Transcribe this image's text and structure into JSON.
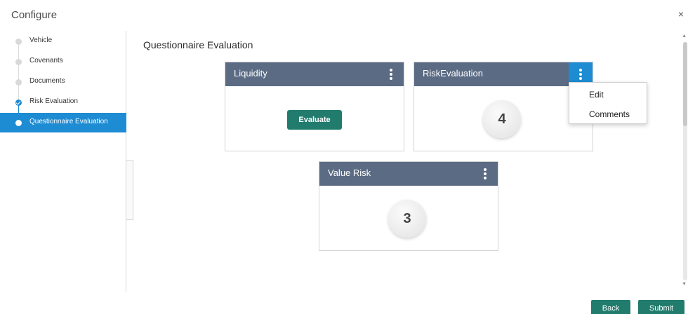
{
  "header": {
    "title": "Configure",
    "close_glyph": "×"
  },
  "sidebar": {
    "steps": [
      {
        "label": "Vehicle",
        "state": "pending"
      },
      {
        "label": "Covenants",
        "state": "pending"
      },
      {
        "label": "Documents",
        "state": "pending"
      },
      {
        "label": "Risk Evaluation",
        "state": "done"
      },
      {
        "label": "Questionnaire Evaluation",
        "state": "active"
      }
    ]
  },
  "main": {
    "section_title": "Questionnaire Evaluation",
    "cards": [
      {
        "title": "Liquidity",
        "action_label": "Evaluate"
      },
      {
        "title": "RiskEvaluation",
        "score": "4"
      },
      {
        "title": "Value Risk",
        "score": "3"
      }
    ],
    "context_menu": {
      "items": [
        "Edit",
        "Comments"
      ]
    }
  },
  "footer": {
    "back_label": "Back",
    "submit_label": "Submit"
  },
  "colors": {
    "card_header": "#5b6b84",
    "accent_blue": "#1e8cd3",
    "button_green": "#217c6e"
  },
  "icons": {
    "close": "close-icon",
    "kebab": "kebab-menu-icon",
    "step_check": "check-icon",
    "step_dot": "step-dot-icon"
  }
}
